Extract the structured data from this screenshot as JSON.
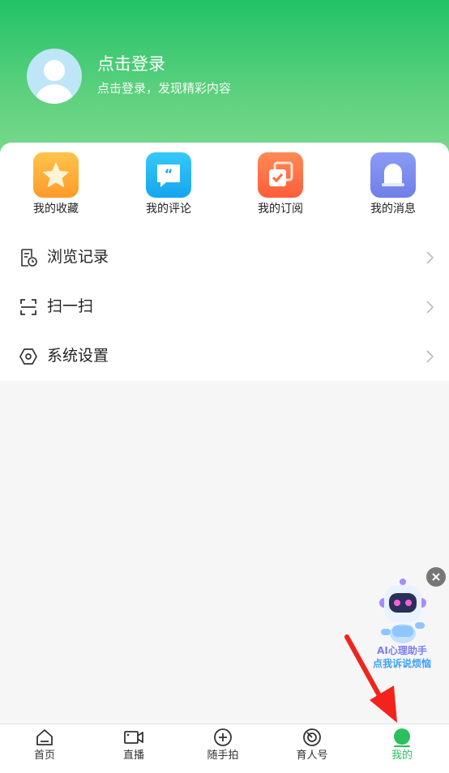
{
  "profile": {
    "title": "点击登录",
    "subtitle": "点击登录，发现精彩内容"
  },
  "quick_actions": [
    {
      "label": "我的收藏",
      "icon": "star-icon"
    },
    {
      "label": "我的评论",
      "icon": "comment-icon"
    },
    {
      "label": "我的订阅",
      "icon": "subscribe-icon"
    },
    {
      "label": "我的消息",
      "icon": "bell-icon"
    }
  ],
  "menu": [
    {
      "label": "浏览记录",
      "icon": "history-icon"
    },
    {
      "label": "扫一扫",
      "icon": "scan-icon"
    },
    {
      "label": "系统设置",
      "icon": "settings-icon"
    }
  ],
  "assistant": {
    "line1": "AI心理助手",
    "line2": "点我诉说烦恼"
  },
  "tabs": [
    {
      "label": "首页",
      "icon": "home-icon"
    },
    {
      "label": "直播",
      "icon": "video-icon"
    },
    {
      "label": "随手拍",
      "icon": "plus-circle-icon"
    },
    {
      "label": "育人号",
      "icon": "target-icon"
    },
    {
      "label": "我的",
      "icon": "profile-icon",
      "active": true
    }
  ],
  "colors": {
    "brand_green": "#22c267",
    "active_tab": "#2bbf5e",
    "arrow_red": "#f2231c"
  }
}
